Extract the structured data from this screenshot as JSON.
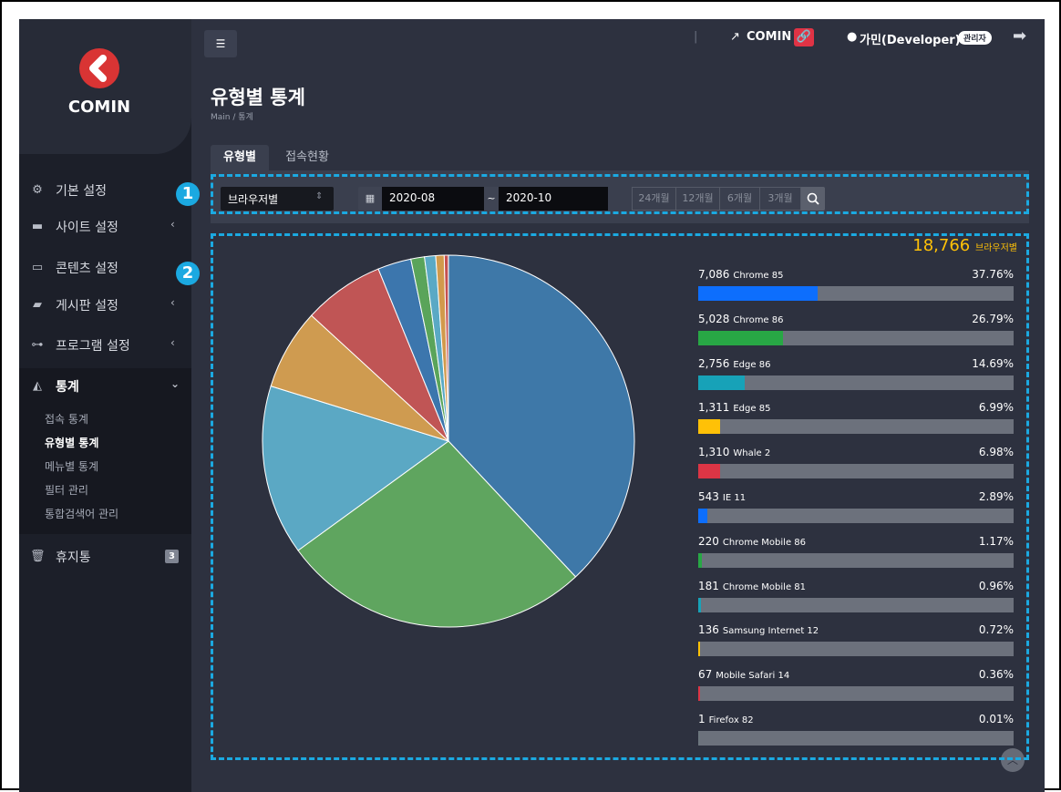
{
  "sidebar": {
    "logo_text": "COMIN",
    "items": [
      {
        "label": "기본 설정",
        "icon": "gears-icon"
      },
      {
        "label": "사이트 설정",
        "icon": "site-icon"
      },
      {
        "label": "콘텐츠 설정",
        "icon": "content-icon"
      },
      {
        "label": "게시판 설정",
        "icon": "board-icon"
      },
      {
        "label": "프로그램 설정",
        "icon": "program-icon"
      },
      {
        "label": "통계",
        "icon": "chart-icon"
      },
      {
        "label": "휴지통",
        "icon": "trash-icon",
        "badge": "3"
      }
    ],
    "sub_items": [
      "접속 통계",
      "유형별 통계",
      "메뉴별 통계",
      "필터 관리",
      "통합검색어 관리"
    ]
  },
  "header": {
    "site_link": "COMIN",
    "user": "가민(Developer)",
    "role_badge": "관리자"
  },
  "page": {
    "title": "유형별 통계",
    "breadcrumb": "Main  /  통계"
  },
  "tabs": [
    "유형별",
    "접속현황"
  ],
  "filter": {
    "type_value": "브라우저별",
    "date_from": "2020-08",
    "date_sep": "~",
    "date_to": "2020-10",
    "ranges": [
      "24개월",
      "12개월",
      "6개월",
      "3개월"
    ]
  },
  "total": {
    "count": "18,766",
    "label": "브라우저별"
  },
  "annotations": [
    "1",
    "2"
  ],
  "chart_data": {
    "type": "pie",
    "categories": [
      "Chrome 85",
      "Chrome 86",
      "Edge 86",
      "Edge 85",
      "Whale 2",
      "IE 11",
      "Chrome Mobile 86",
      "Chrome Mobile 81",
      "Samsung Internet 12",
      "Mobile Safari 14",
      "Firefox 82"
    ],
    "values": [
      7086,
      5028,
      2756,
      1311,
      1310,
      543,
      220,
      181,
      136,
      67,
      1
    ],
    "value_labels": [
      "7,086",
      "5,028",
      "2,756",
      "1,311",
      "1,310",
      "543",
      "220",
      "181",
      "136",
      "67",
      "1"
    ],
    "percents": [
      "37.76%",
      "26.79%",
      "14.69%",
      "6.99%",
      "6.98%",
      "2.89%",
      "1.17%",
      "0.96%",
      "0.72%",
      "0.36%",
      "0.01%"
    ],
    "slice_colors": [
      "#3e78a8",
      "#5fa55f",
      "#5ba8c4",
      "#cf9b50",
      "#c05555",
      "#3c76ad",
      "#5aa45a",
      "#5aa9c5",
      "#d19a4c",
      "#c45050",
      "#ffffff"
    ],
    "bar_colors": [
      "#0d6efd",
      "#28a745",
      "#17a2b8",
      "#ffc107",
      "#dc3545",
      "#0d6efd",
      "#28a745",
      "#17a2b8",
      "#ffc107",
      "#dc3545",
      "#6c757d"
    ]
  }
}
